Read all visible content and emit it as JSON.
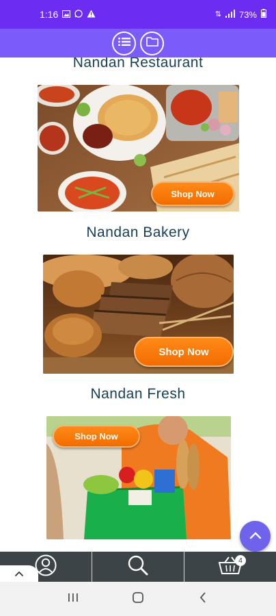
{
  "status_bar": {
    "time": "1:16",
    "battery": "73%",
    "notification_icons": [
      "gallery-icon",
      "whatsapp-icon",
      "warning-icon"
    ],
    "right_icons": [
      "data-icon",
      "signal-icon",
      "battery-icon"
    ]
  },
  "header": {
    "buttons": [
      {
        "icon": "list-icon"
      },
      {
        "icon": "folder-icon"
      }
    ]
  },
  "sections": [
    {
      "title": "Nandan Restaurant",
      "button": "Shop Now"
    },
    {
      "title": "Nandan Bakery",
      "button": "Shop Now"
    },
    {
      "title": "Nandan Fresh",
      "button": "Shop Now"
    }
  ],
  "bottom_nav": {
    "items": [
      {
        "icon": "account-icon"
      },
      {
        "icon": "search-icon"
      },
      {
        "icon": "cart-icon",
        "badge": "4"
      }
    ]
  },
  "colors": {
    "status_bar": "#6d2cf2",
    "header": "#7b5cfa",
    "title_text": "#16405a",
    "shop_button": "#f26c00",
    "bottom_bar": "#3d4447",
    "fab": "#6f63ee"
  }
}
